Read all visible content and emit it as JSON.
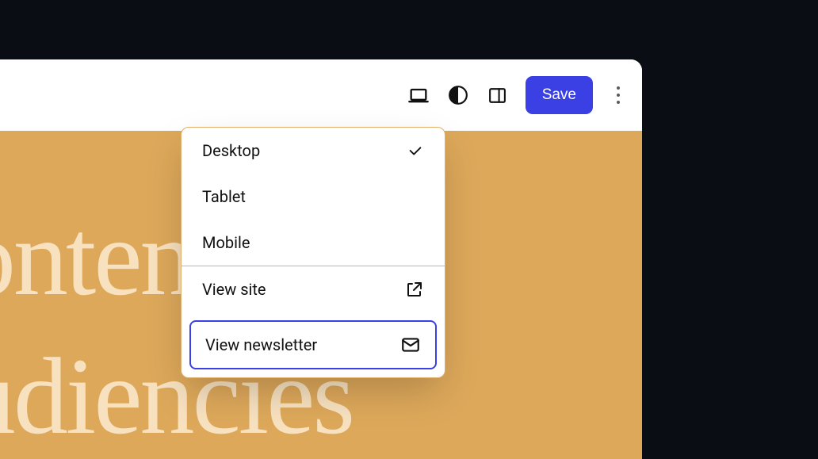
{
  "toolbar": {
    "save_label": "Save"
  },
  "dropdown": {
    "devices": [
      {
        "label": "Desktop",
        "selected": true
      },
      {
        "label": "Tablet",
        "selected": false
      },
      {
        "label": "Mobile",
        "selected": false
      }
    ],
    "actions": {
      "view_site": "View site",
      "view_newsletter": "View newsletter"
    }
  },
  "canvas": {
    "line1": "re content for",
    "line2": "re audiencies"
  }
}
